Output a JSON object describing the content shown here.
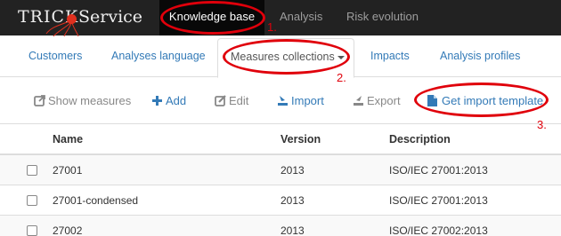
{
  "navbar": {
    "logo_prefix": "TRICK",
    "logo_suffix": "Service",
    "items": [
      {
        "label": "Knowledge base",
        "active": true
      },
      {
        "label": "Analysis",
        "active": false
      },
      {
        "label": "Risk evolution",
        "active": false
      }
    ]
  },
  "tabs": [
    {
      "label": "Customers",
      "active": false
    },
    {
      "label": "Analyses language",
      "active": false
    },
    {
      "label": "Measures collections",
      "active": true,
      "dropdown": true
    },
    {
      "label": "Impacts",
      "active": false
    },
    {
      "label": "Analysis profiles",
      "active": false
    }
  ],
  "toolbar": {
    "show_measures": {
      "label": "Show measures",
      "icon": "external-link-icon",
      "enabled": false
    },
    "add": {
      "label": "Add",
      "icon": "plus-icon",
      "enabled": true
    },
    "edit": {
      "label": "Edit",
      "icon": "edit-icon",
      "enabled": false
    },
    "import": {
      "label": "Import",
      "icon": "import-icon",
      "enabled": true
    },
    "export": {
      "label": "Export",
      "icon": "export-icon",
      "enabled": false
    },
    "template": {
      "label": "Get import template",
      "icon": "file-icon",
      "enabled": true
    }
  },
  "table": {
    "columns": [
      "Name",
      "Version",
      "Description"
    ],
    "rows": [
      {
        "name": "27001",
        "version": "2013",
        "description": "ISO/IEC 27001:2013"
      },
      {
        "name": "27001-condensed",
        "version": "2013",
        "description": "ISO/IEC 27001:2013"
      },
      {
        "name": "27002",
        "version": "2013",
        "description": "ISO/IEC 27002:2013"
      }
    ]
  },
  "annotations": [
    "1.",
    "2.",
    "3."
  ],
  "colors": {
    "navbar_bg": "#222222",
    "link": "#337ab7",
    "annotation": "#e0000b",
    "logo_dot": "#e0301e"
  }
}
